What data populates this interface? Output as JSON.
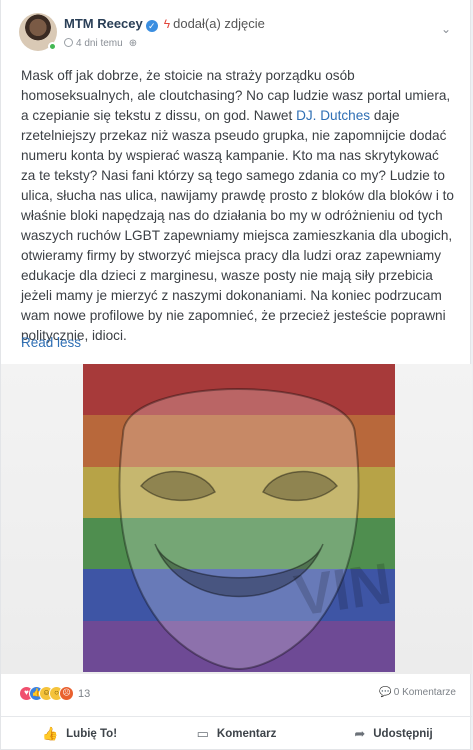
{
  "post": {
    "author": "MTM Reecey",
    "action": "dodał(a) zdjęcie",
    "time": "4 dni temu",
    "text_before_mention": "Mask off jak dobrze, że stoicie na straży porządku osób homoseksualnych, ale cloutchasing? No cap ludzie wasz portal umiera, a czepianie się tekstu z dissu, on god. Nawet ",
    "mention": "DJ. Dutches",
    "text_after_mention": " daje rzetelniejszy przekaz niż wasza pseudo grupka, nie zapomnijcie dodać numeru konta by wspierać waszą kampanie. Kto ma nas skrytykować za te teksty? Nasi fani którzy są tego samego zdania co my? Ludzie to ulica, słucha nas ulica, nawijamy prawdę prosto z bloków dla bloków i to właśnie bloki napędzają nas do działania bo my w odróżnieniu od tych waszych ruchów LGBT zapewniamy miejsca zamieszkania dla ubogich, otwieramy firmy by stworzyć miejsca pracy dla ludzi oraz zapewniamy edukacje dla dzieci z marginesu, wasze posty nie mają siły przebicia jeżeli mamy je mierzyć z naszymi dokonaniami. Na koniec podrzucam wam nowe profilowe by nie zapomnieć, że przecież jesteście poprawni politycznie, idioci.",
    "read_less": "Read less"
  },
  "photo": {
    "stripe_colors": [
      "#a73a3a",
      "#b8683b",
      "#b7a347",
      "#4f8e4f",
      "#3e55a5",
      "#6e4a95"
    ],
    "watermark": "VIN"
  },
  "stats": {
    "reactions": [
      "love",
      "like",
      "haha",
      "wow",
      "angry"
    ],
    "reaction_count": "13",
    "comments": "0 Komentarze"
  },
  "actions": {
    "like": "Lubię To!",
    "comment": "Komentarz",
    "share": "Udostępnij"
  }
}
